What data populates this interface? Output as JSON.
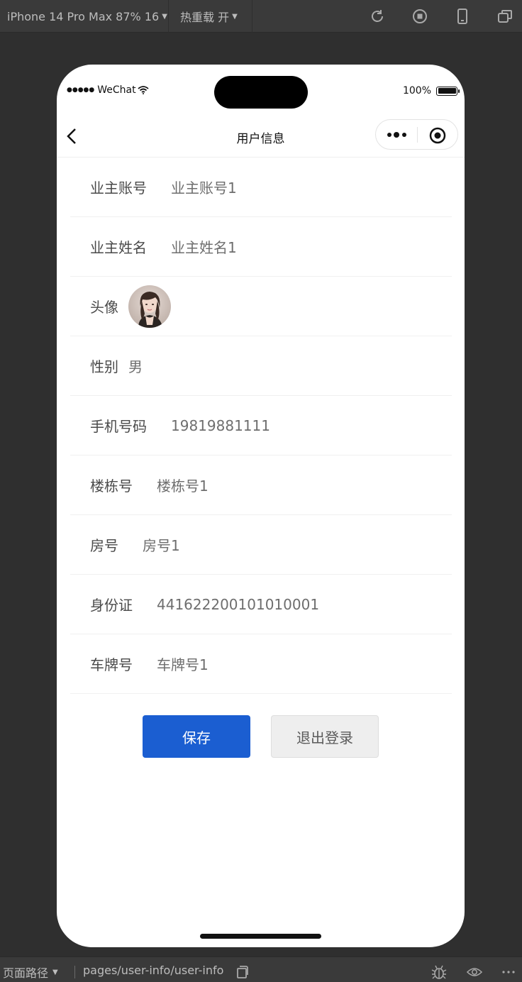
{
  "toolbar": {
    "device_label": "iPhone 14 Pro Max 87% 16",
    "hot_reload_label": "热重载 开",
    "icons": [
      "refresh-icon",
      "stop-icon",
      "phone-icon",
      "window-icon"
    ]
  },
  "status_bar": {
    "carrier": "WeChat",
    "battery": "100%"
  },
  "navbar": {
    "title": "用户信息"
  },
  "fields": [
    {
      "label": "业主账号",
      "value": "业主账号1"
    },
    {
      "label": "业主姓名",
      "value": "业主姓名1"
    },
    {
      "label": "头像",
      "value": ""
    },
    {
      "label": "性别",
      "value": "男"
    },
    {
      "label": "手机号码",
      "value": "19819881111"
    },
    {
      "label": "楼栋号",
      "value": "楼栋号1"
    },
    {
      "label": "房号",
      "value": "房号1"
    },
    {
      "label": "身份证",
      "value": "441622200101010001"
    },
    {
      "label": "车牌号",
      "value": "车牌号1"
    }
  ],
  "actions": {
    "save": "保存",
    "logout": "退出登录"
  },
  "bottom_bar": {
    "route_label": "页面路径",
    "path": "pages/user-info/user-info"
  },
  "colors": {
    "primary": "#1b5ed1",
    "background": "#2f2f2f"
  }
}
